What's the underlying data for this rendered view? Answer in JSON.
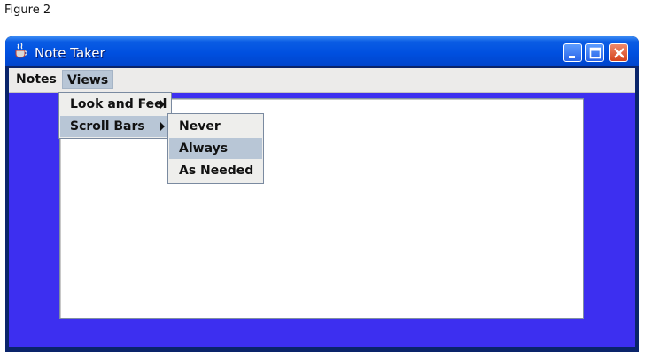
{
  "figure_caption": "Figure 2",
  "window": {
    "title": "Note Taker",
    "buttons": [
      "minimize-icon",
      "maximize-icon",
      "close-icon"
    ],
    "icon": "java-cup-icon"
  },
  "menubar": {
    "notes_label": "Notes",
    "views_label": "Views",
    "active_menu": "Views"
  },
  "views_menu": {
    "items": [
      {
        "label": "Look and Feel",
        "has_submenu": true,
        "selected": false
      },
      {
        "label": "Scroll Bars",
        "has_submenu": true,
        "selected": true
      }
    ]
  },
  "scroll_bars_menu": {
    "items": [
      {
        "label": "Never",
        "selected": false
      },
      {
        "label": "Always",
        "selected": true
      },
      {
        "label": "As Needed",
        "selected": false
      }
    ]
  },
  "colors": {
    "titlebar": "#0050e0",
    "client_background": "#3d2ff0",
    "menu_highlight": "#b8c6d6"
  }
}
